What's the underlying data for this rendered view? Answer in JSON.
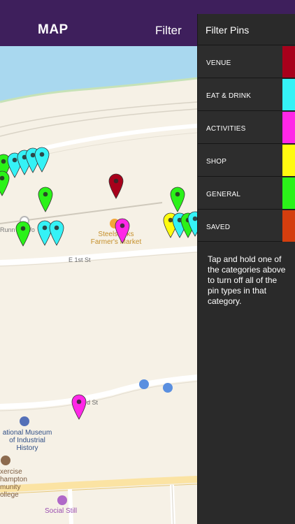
{
  "appbar": {
    "title": "MAP",
    "filter_label": "Filter"
  },
  "drawer": {
    "title": "Filter Pins",
    "categories": [
      {
        "label": "VENUE",
        "color": "#a8001b"
      },
      {
        "label": "EAT & DRINK",
        "color": "#35f2f6"
      },
      {
        "label": "ACTIVITIES",
        "color": "#ff27e7"
      },
      {
        "label": "SHOP",
        "color": "#fffb10"
      },
      {
        "label": "GENERAL",
        "color": "#2bf219"
      },
      {
        "label": "SAVED",
        "color": "#d43e0e"
      }
    ],
    "help_text": "Tap and hold one of the categories above to turn off all of the pin types in that category."
  },
  "map": {
    "labels": {
      "running_wo": "Runn      Wo",
      "market_line1": "Steelstacks",
      "market_line2": "Farmer's Market",
      "street_e1st": "E 1st St",
      "street_3rd": "d St",
      "museum_line1": "ational Museum",
      "museum_line2": "of Industrial",
      "museum_line3": "History",
      "college_line1": "xercise",
      "college_line2": "hampton",
      "college_line3": "munity",
      "college_line4": "ollege",
      "social_still": "Social Still"
    },
    "pin_colors": {
      "venue": "#a8001b",
      "eat_drink": "#35f2f6",
      "activities": "#ff27e7",
      "shop": "#fffb10",
      "general": "#2bf219"
    }
  }
}
